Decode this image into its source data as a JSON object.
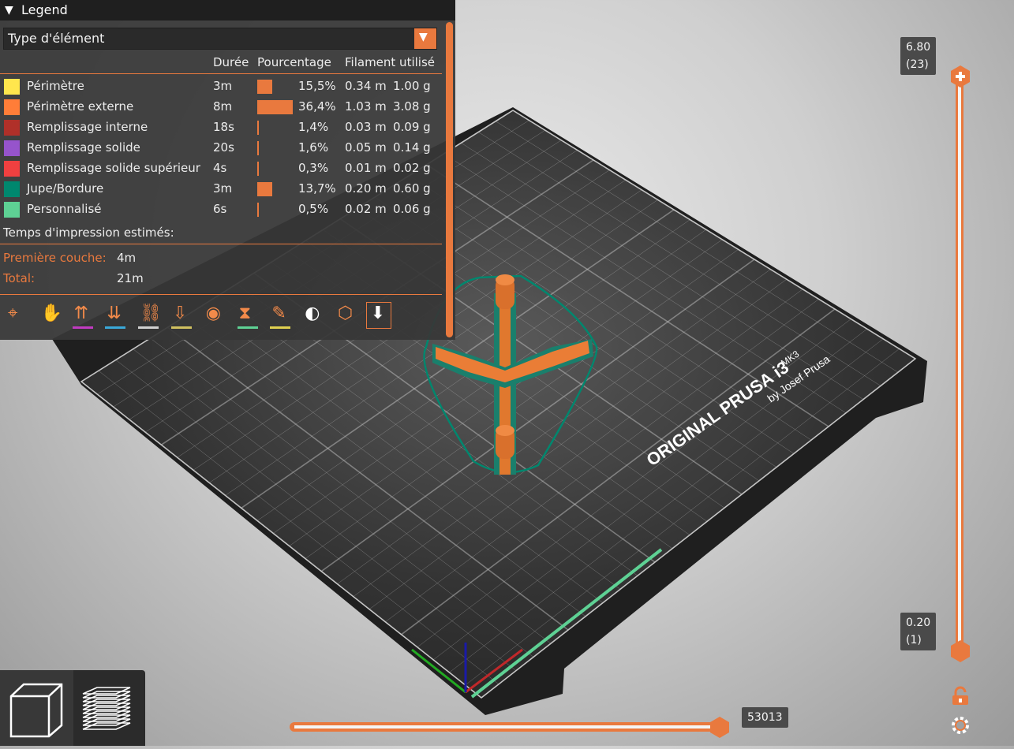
{
  "legend": {
    "title": "Legend",
    "view_type": "Type d'élément",
    "columns": {
      "duration": "Durée",
      "percentage": "Pourcentage",
      "filament": "Filament utilisé"
    },
    "items": [
      {
        "name": "Périmètre",
        "color": "#ffe64d",
        "duration": "3m",
        "percent": "15,5%",
        "fraction": 0.155,
        "length": "0.34 m",
        "weight": "1.00 g"
      },
      {
        "name": "Périmètre externe",
        "color": "#ff7d38",
        "duration": "8m",
        "percent": "36,4%",
        "fraction": 0.364,
        "length": "1.03 m",
        "weight": "3.08 g"
      },
      {
        "name": "Remplissage interne",
        "color": "#b03029",
        "duration": "18s",
        "percent": "1,4%",
        "fraction": 0.014,
        "length": "0.03 m",
        "weight": "0.09 g"
      },
      {
        "name": "Remplissage solide",
        "color": "#9654cc",
        "duration": "20s",
        "percent": "1,6%",
        "fraction": 0.016,
        "length": "0.05 m",
        "weight": "0.14 g"
      },
      {
        "name": "Remplissage solide supérieur",
        "color": "#f04040",
        "duration": "4s",
        "percent": "0,3%",
        "fraction": 0.003,
        "length": "0.01 m",
        "weight": "0.02 g"
      },
      {
        "name": "Jupe/Bordure",
        "color": "#00876e",
        "duration": "3m",
        "percent": "13,7%",
        "fraction": 0.137,
        "length": "0.20 m",
        "weight": "0.60 g"
      },
      {
        "name": "Personnalisé",
        "color": "#5ed194",
        "duration": "6s",
        "percent": "0,5%",
        "fraction": 0.005,
        "length": "0.02 m",
        "weight": "0.06 g"
      }
    ],
    "estimated_title": "Temps d'impression estimés:",
    "first_layer_label": "Première couche:",
    "first_layer_value": "4m",
    "total_label": "Total:",
    "total_value": "21m",
    "toolbar": [
      {
        "icon": "travel-icon",
        "underline": ""
      },
      {
        "icon": "wipe-icon",
        "underline": ""
      },
      {
        "icon": "retractions-icon",
        "underline": "#c03bc0"
      },
      {
        "icon": "deretractions-icon",
        "underline": "#3aa8d8"
      },
      {
        "icon": "seams-icon",
        "underline": "#d0d0d0"
      },
      {
        "icon": "tool-changes-icon",
        "underline": "#d0c060"
      },
      {
        "icon": "color-changes-icon",
        "underline": ""
      },
      {
        "icon": "pause-icon",
        "underline": "#5ed194"
      },
      {
        "icon": "custom-gcode-icon",
        "underline": "#e0d050"
      },
      {
        "icon": "center-of-gravity-icon",
        "underline": ""
      },
      {
        "icon": "shells-icon",
        "underline": ""
      },
      {
        "icon": "tool-marker-icon",
        "underline": ""
      }
    ]
  },
  "bed_label": {
    "brand": "ORIGINAL PRUSA i3",
    "model": "MK3",
    "by": "by Josef Prusa"
  },
  "vertical_slider": {
    "top_value": "6.80",
    "top_layer": "(23)",
    "bottom_value": "0.20",
    "bottom_layer": "(1)",
    "accent": "#e9793e"
  },
  "horizontal_slider": {
    "value": "53013"
  },
  "view_buttons": [
    "3d-view-icon",
    "preview-layers-icon"
  ]
}
